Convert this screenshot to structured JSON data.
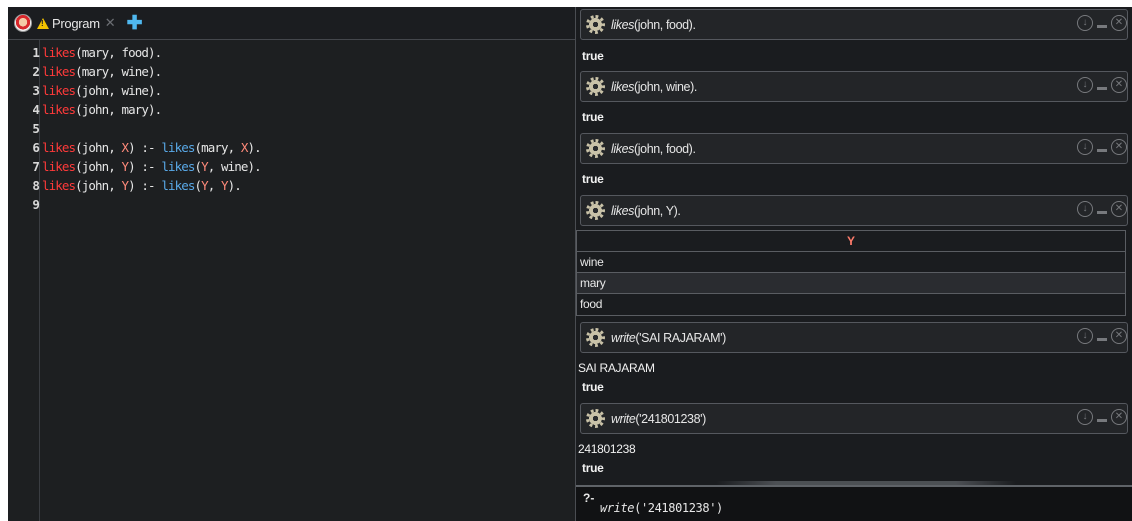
{
  "editor": {
    "tab": {
      "label": "Program"
    },
    "lines": [
      {
        "n": "1",
        "parts": [
          [
            "pred",
            "likes"
          ],
          [
            "plain",
            "(mary, food)."
          ]
        ]
      },
      {
        "n": "2",
        "parts": [
          [
            "pred",
            "likes"
          ],
          [
            "plain",
            "(mary, wine)."
          ]
        ]
      },
      {
        "n": "3",
        "parts": [
          [
            "pred",
            "likes"
          ],
          [
            "plain",
            "(john, wine)."
          ]
        ]
      },
      {
        "n": "4",
        "parts": [
          [
            "pred",
            "likes"
          ],
          [
            "plain",
            "(john, mary)."
          ]
        ]
      },
      {
        "n": "5",
        "parts": []
      },
      {
        "n": "6",
        "parts": [
          [
            "pred",
            "likes"
          ],
          [
            "plain",
            "(john, "
          ],
          [
            "var",
            "X"
          ],
          [
            "plain",
            ") :- "
          ],
          [
            "call",
            "likes"
          ],
          [
            "plain",
            "(mary, "
          ],
          [
            "var",
            "X"
          ],
          [
            "plain",
            ")."
          ]
        ]
      },
      {
        "n": "7",
        "parts": [
          [
            "pred",
            "likes"
          ],
          [
            "plain",
            "(john, "
          ],
          [
            "var",
            "Y"
          ],
          [
            "plain",
            ") :- "
          ],
          [
            "call",
            "likes"
          ],
          [
            "plain",
            "("
          ],
          [
            "var",
            "Y"
          ],
          [
            "plain",
            ", wine)."
          ]
        ]
      },
      {
        "n": "8",
        "parts": [
          [
            "pred",
            "likes"
          ],
          [
            "plain",
            "(john, "
          ],
          [
            "var",
            "Y"
          ],
          [
            "plain",
            ") :- "
          ],
          [
            "call",
            "likes"
          ],
          [
            "plain",
            "("
          ],
          [
            "var",
            "Y"
          ],
          [
            "plain",
            ", "
          ],
          [
            "var",
            "Y"
          ],
          [
            "plain",
            ")."
          ]
        ]
      },
      {
        "n": "9",
        "parts": []
      }
    ]
  },
  "answers": {
    "q1": {
      "pred": "likes",
      "args": "(john, food).",
      "result": "true"
    },
    "q2": {
      "pred": "likes",
      "args": "(john, wine).",
      "result": "true"
    },
    "q3": {
      "pred": "likes",
      "args": "(john, food).",
      "result": "true"
    },
    "q4": {
      "pred": "likes",
      "args": "(john, Y)."
    },
    "table": {
      "header": "Y",
      "rows": [
        "wine",
        "mary",
        "food"
      ]
    },
    "q5": {
      "pred": "write",
      "args": "('SAI RAJARAM')",
      "output": "SAI RAJARAM",
      "result": "true"
    },
    "q6": {
      "pred": "write",
      "args": "('241801238')",
      "output": "241801238",
      "result": "true"
    }
  },
  "prompt": {
    "symbol": "?-",
    "pred": "write",
    "args": "('241801238')"
  }
}
